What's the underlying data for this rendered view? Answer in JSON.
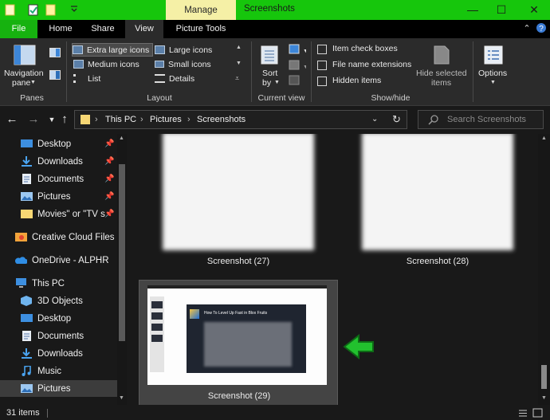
{
  "window": {
    "title": "Screenshots",
    "context_tab": "Manage",
    "controls": {
      "minimize": "—",
      "maximize": "☐",
      "close": "✕"
    }
  },
  "tabs": [
    {
      "label": "File"
    },
    {
      "label": "Home"
    },
    {
      "label": "Share"
    },
    {
      "label": "View"
    },
    {
      "label": "Picture Tools"
    }
  ],
  "ribbon": {
    "panes": {
      "nav_pane_label_1": "Navigation",
      "nav_pane_label_2": "pane",
      "group_label": "Panes"
    },
    "layout": {
      "items": [
        {
          "label": "Extra large icons"
        },
        {
          "label": "Large icons"
        },
        {
          "label": "Medium icons"
        },
        {
          "label": "Small icons"
        },
        {
          "label": "List"
        },
        {
          "label": "Details"
        }
      ],
      "group_label": "Layout"
    },
    "current_view": {
      "sort_label_1": "Sort",
      "sort_label_2": "by",
      "group_label": "Current view"
    },
    "show_hide": {
      "item_check_boxes": "Item check boxes",
      "file_name_extensions": "File name extensions",
      "hidden_items": "Hidden items",
      "hide_selected_1": "Hide selected",
      "hide_selected_2": "items",
      "group_label": "Show/hide"
    },
    "options": {
      "label": "Options"
    }
  },
  "address": {
    "crumbs": [
      "This PC",
      "Pictures",
      "Screenshots"
    ],
    "search_placeholder": "Search Screenshots"
  },
  "nav_pane": {
    "items": [
      {
        "label": "Desktop",
        "pinned": true
      },
      {
        "label": "Downloads",
        "pinned": true
      },
      {
        "label": "Documents",
        "pinned": true
      },
      {
        "label": "Pictures",
        "pinned": true
      },
      {
        "label": "Movies\" or \"TV sh",
        "pinned": true
      },
      {
        "label": "Creative Cloud Files"
      },
      {
        "label": "OneDrive - ALPHR"
      },
      {
        "label": "This PC"
      },
      {
        "label": "3D Objects"
      },
      {
        "label": "Desktop"
      },
      {
        "label": "Documents"
      },
      {
        "label": "Downloads"
      },
      {
        "label": "Music"
      },
      {
        "label": "Pictures",
        "selected": true
      }
    ]
  },
  "files": [
    {
      "name": "Screenshot (27)"
    },
    {
      "name": "Screenshot (28)"
    },
    {
      "name": "Screenshot (29)",
      "selected": true,
      "preview_title": "How To Level Up Fast in Blox Fruits"
    }
  ],
  "status": {
    "count": "31 items"
  },
  "colors": {
    "accent": "#16c60c",
    "arrow": "#22c12e",
    "manage_bg": "#f5f0a6"
  }
}
